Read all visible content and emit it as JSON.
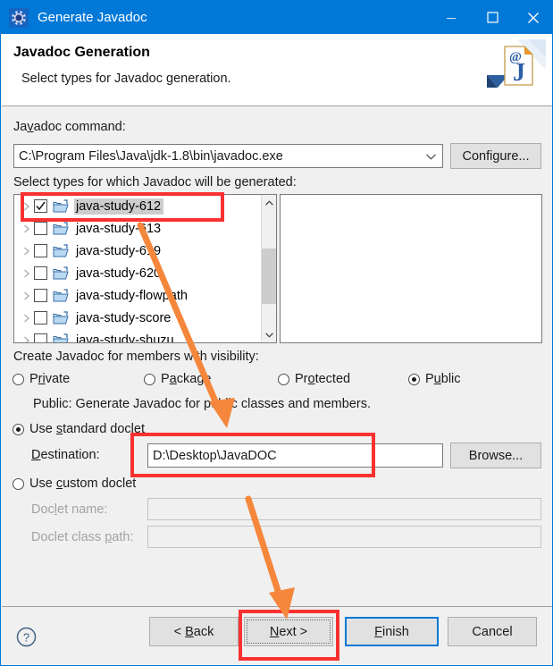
{
  "window": {
    "title": "Generate Javadoc",
    "app_icon": "gear-icon",
    "minimize_label": "Minimize",
    "maximize_label": "Maximize",
    "close_label": "Close"
  },
  "header": {
    "title": "Javadoc Generation",
    "subtitle": "Select types for Javadoc generation.",
    "banner_icon": "javadoc-page-icon"
  },
  "command": {
    "label": "Javadoc command:",
    "label_pre": "Ja",
    "label_mnemonic": "v",
    "label_post": "adoc command:",
    "value": "C:\\Program Files\\Java\\jdk-1.8\\bin\\javadoc.exe",
    "configure_label": "Configure...",
    "configure_pre": "Configure..."
  },
  "types": {
    "label": "Select types for which Javadoc will be generated:",
    "items": [
      {
        "label": "java-study-612",
        "checked": true,
        "selected": true
      },
      {
        "label": "java-study-613",
        "checked": false,
        "selected": false
      },
      {
        "label": "java-study-619",
        "checked": false,
        "selected": false
      },
      {
        "label": "java-study-620",
        "checked": false,
        "selected": false
      },
      {
        "label": "java-study-flowpath",
        "checked": false,
        "selected": false
      },
      {
        "label": "java-study-score",
        "checked": false,
        "selected": false
      },
      {
        "label": "java-study-shuzu",
        "checked": false,
        "selected": false
      }
    ],
    "right_panel_content": ""
  },
  "visibility": {
    "label": "Create Javadoc for members with visibility:",
    "options": [
      {
        "label": "Private",
        "pre": "P",
        "mnemonic": "ri",
        "post": "vate",
        "checked": false
      },
      {
        "label": "Package",
        "pre": "P",
        "mnemonic": "a",
        "post": "ckage",
        "checked": false
      },
      {
        "label": "Protected",
        "pre": "Pr",
        "mnemonic": "o",
        "post": "tected",
        "checked": false
      },
      {
        "label": "Public",
        "pre": "P",
        "mnemonic": "u",
        "post": "blic",
        "checked": true
      }
    ],
    "description": "Public: Generate Javadoc for public classes and members."
  },
  "doclet": {
    "standard": {
      "label": "Use standard doclet",
      "checked": true
    },
    "custom": {
      "label": "Use custom doclet",
      "checked": false
    },
    "destination_label": "Destination:",
    "destination_value": "D:\\Desktop\\JavaDOC",
    "destination_placeholder": "",
    "browse_label": "Browse...",
    "doclet_name_label": "Doclet name:",
    "doclet_name_value": "",
    "doclet_classpath_label": "Doclet class path:",
    "doclet_classpath_value": ""
  },
  "footer": {
    "help_icon": "help-circle-icon",
    "back_label": "< Back",
    "next_label": "Next >",
    "finish_label": "Finish",
    "cancel_label": "Cancel"
  },
  "annotations": {
    "highlight_color": "#f93131",
    "arrow_color": "#f5873c",
    "boxes": [
      {
        "name": "tree-first-item-highlight"
      },
      {
        "name": "destination-field-highlight"
      },
      {
        "name": "next-button-highlight"
      }
    ],
    "arrows": [
      {
        "name": "arrow-to-destination"
      },
      {
        "name": "arrow-to-next-button"
      }
    ]
  }
}
